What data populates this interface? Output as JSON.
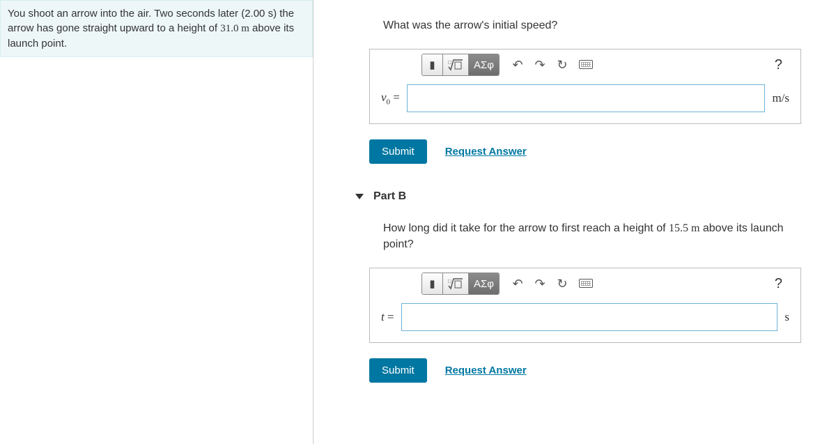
{
  "problem": {
    "text_before": "You shoot an arrow into the air. Two seconds later (2.00 s) the arrow has gone straight upward to a height of ",
    "distance": "31.0 m",
    "text_after": " above its launch point."
  },
  "partA": {
    "question": "What was the arrow's initial speed?",
    "toolbar": {
      "templates": "▮",
      "sqrt": "√",
      "greek": "ΑΣφ",
      "undo": "↶",
      "redo": "↷",
      "reset": "↻",
      "help": "?"
    },
    "var_html": "<i>v</i><sub>0</sub>",
    "eq": " = ",
    "unit": "m/s",
    "value": "",
    "submit": "Submit",
    "request": "Request Answer"
  },
  "partB": {
    "header": "Part B",
    "question_before": "How long did it take for the arrow to first reach a height of ",
    "question_dist": "15.5 m",
    "question_after": " above its launch point?",
    "toolbar": {
      "templates": "▮",
      "sqrt": "√",
      "greek": "ΑΣφ",
      "undo": "↶",
      "redo": "↷",
      "reset": "↻",
      "help": "?"
    },
    "var_html": "<i>t</i>",
    "eq": " = ",
    "unit": "s",
    "value": "",
    "submit": "Submit",
    "request": "Request Answer"
  }
}
